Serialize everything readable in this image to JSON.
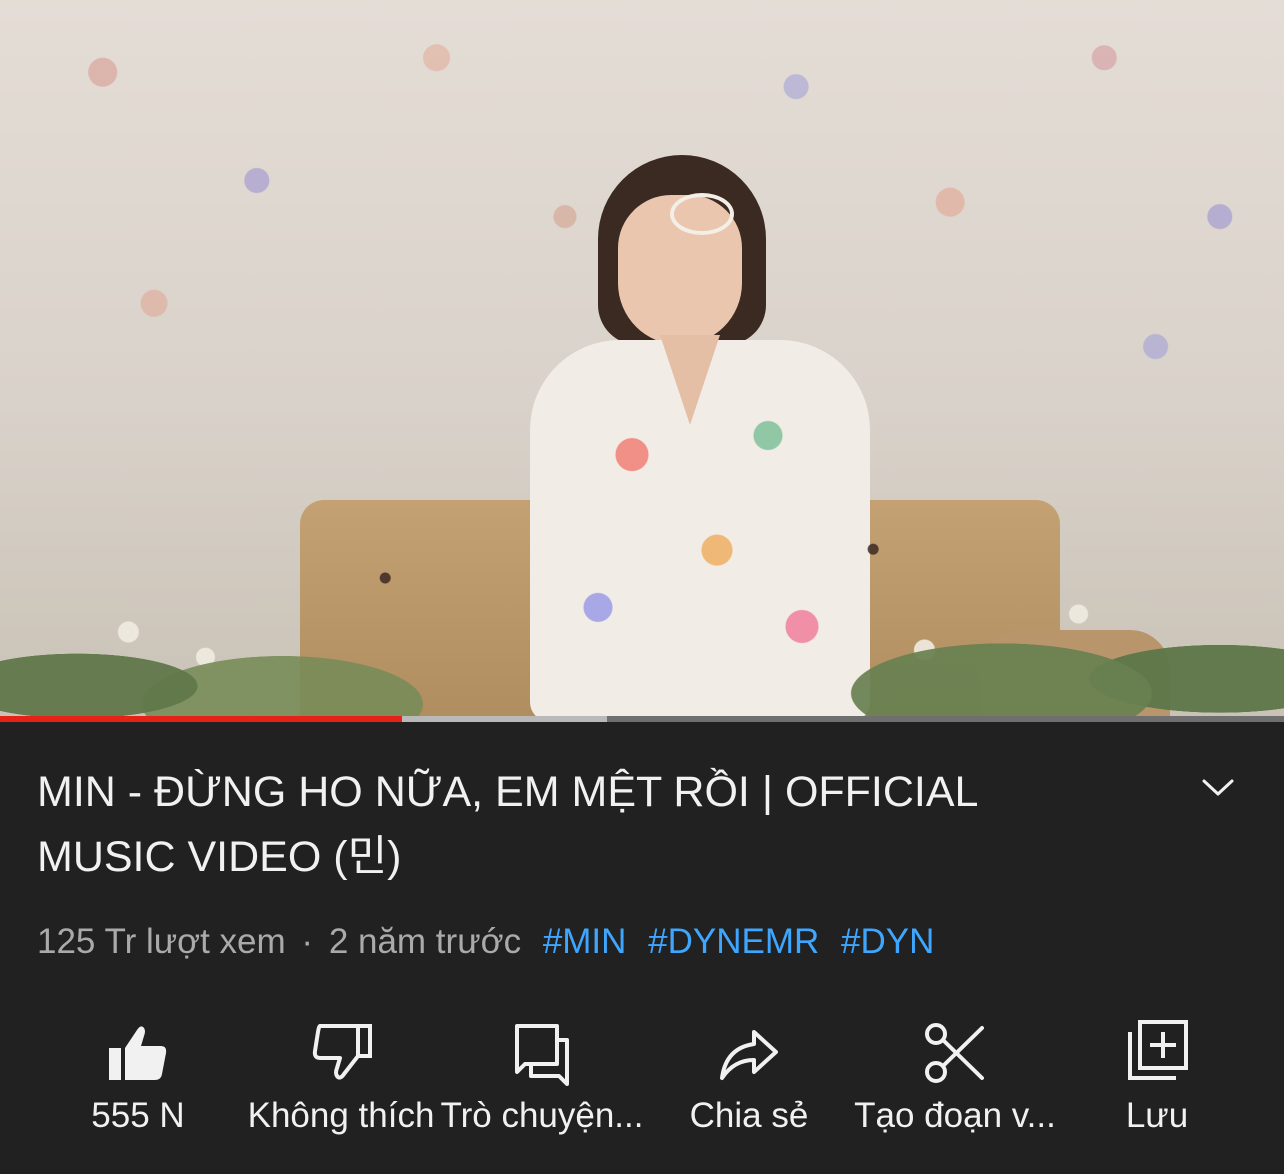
{
  "video": {
    "progress_played": 0.313,
    "progress_buffered": 0.473,
    "progress_color": "#e62117"
  },
  "title": "MIN - ĐỪNG HO NỮA, EM MỆT RỒI | OFFICIAL MUSIC VIDEO (민)",
  "meta": {
    "views": "125 Tr lượt xem",
    "separator": "·",
    "ago": "2 năm trước",
    "hashtags": [
      "#MIN",
      "#DYNEMR",
      "#DYN"
    ],
    "hashtag_color": "#3ea6ff"
  },
  "actions": [
    {
      "label": "555 N",
      "icon": "thumbs-up-icon"
    },
    {
      "label": "Không thích",
      "icon": "thumbs-down-icon"
    },
    {
      "label": "Trò chuyện...",
      "icon": "chat-icon"
    },
    {
      "label": "Chia sẻ",
      "icon": "share-icon"
    },
    {
      "label": "Tạo đoạn v...",
      "icon": "scissors-icon"
    },
    {
      "label": "Lưu",
      "icon": "save-playlist-icon"
    }
  ],
  "expand_icon": "chevron-down-icon"
}
